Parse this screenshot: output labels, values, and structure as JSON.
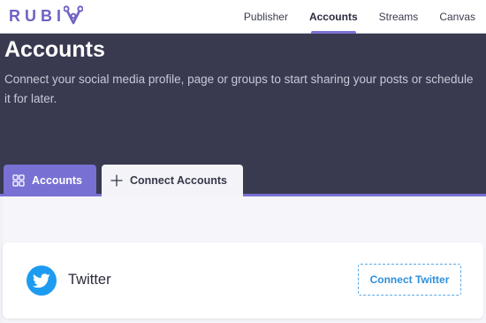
{
  "brand": {
    "logo_text": "RUBI",
    "accent_color": "#7870d3"
  },
  "nav": {
    "items": [
      {
        "label": "Publisher",
        "active": false
      },
      {
        "label": "Accounts",
        "active": true
      },
      {
        "label": "Streams",
        "active": false
      },
      {
        "label": "Canvas",
        "active": false
      }
    ]
  },
  "hero": {
    "title": "Accounts",
    "subtitle": "Connect your social media profile, page or groups to start sharing your posts or schedule it for later."
  },
  "tabs": [
    {
      "label": "Accounts",
      "icon": "grid-icon",
      "active": true
    },
    {
      "label": "Connect Accounts",
      "icon": "plus-icon",
      "active": false
    }
  ],
  "card": {
    "network_icon": "twitter-icon",
    "network_color": "#1d9bf0",
    "title": "Twitter",
    "button_label": "Connect Twitter"
  }
}
